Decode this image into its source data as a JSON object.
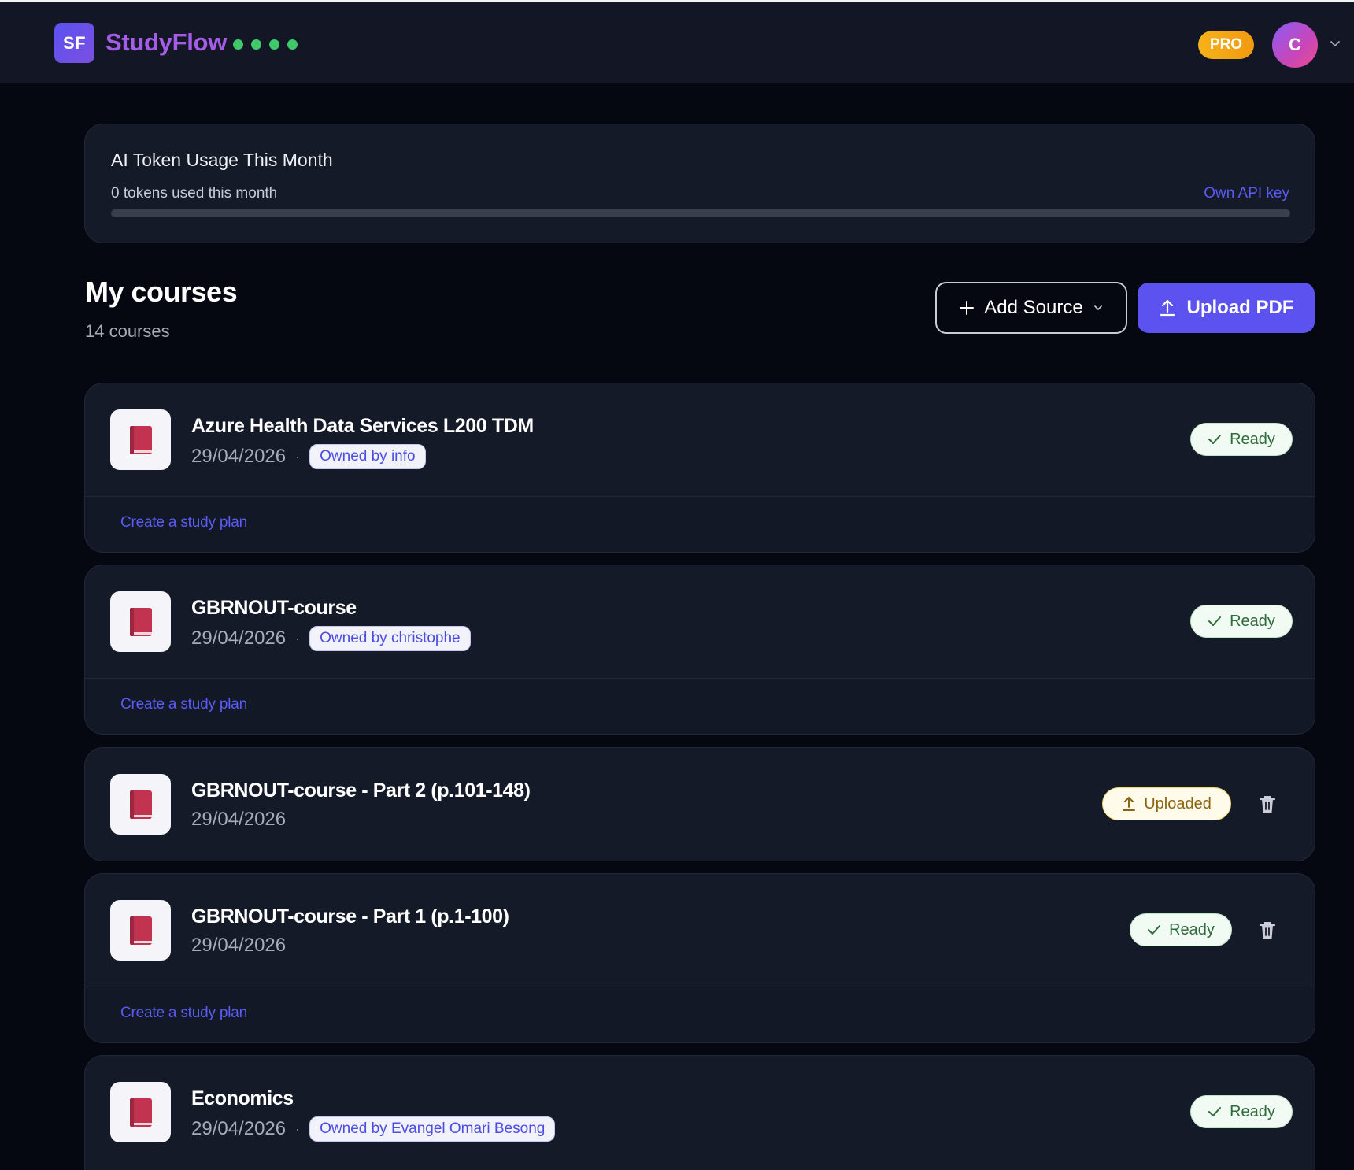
{
  "header": {
    "logo_text": "SF",
    "brand": "StudyFlow",
    "plan_badge": "PRO",
    "avatar_initial": "C",
    "accent_color": "#5b52f0",
    "status_dot_color": "#3fc96b"
  },
  "usage": {
    "title": "AI Token Usage This Month",
    "subtitle": "0 tokens used this month",
    "link_label": "Own API key",
    "progress_fraction": 0
  },
  "section": {
    "title": "My courses",
    "count": "14 courses",
    "add_source_label": "Add Source",
    "upload_label": "Upload PDF"
  },
  "courses": [
    {
      "name": "Azure Health Data Services L200 TDM",
      "date": "29/04/2026",
      "owner": "Owned by info",
      "status": "Ready",
      "study_plan": "Create a study plan"
    },
    {
      "name": "GBRNOUT-course",
      "date": "29/04/2026",
      "owner": "Owned by christophe",
      "status": "Ready",
      "study_plan": "Create a study plan"
    },
    {
      "name": "GBRNOUT-course - Part 2 (p.101-148)",
      "date": "29/04/2026",
      "status": "Uploaded"
    },
    {
      "name": "GBRNOUT-course - Part 1 (p.1-100)",
      "date": "29/04/2026",
      "status": "Ready",
      "study_plan": "Create a study plan"
    },
    {
      "name": "Economics",
      "date": "29/04/2026",
      "owner": "Owned by Evangel Omari Besong",
      "status": "Ready"
    }
  ]
}
